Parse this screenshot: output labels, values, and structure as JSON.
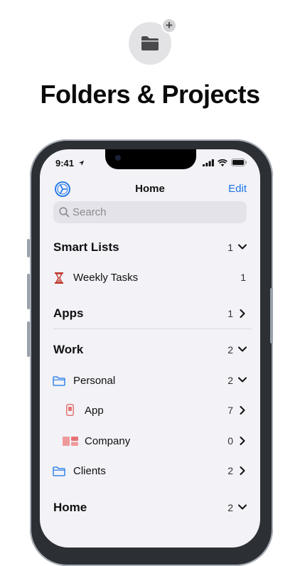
{
  "promo": {
    "headline": "Folders & Projects",
    "badge": "+"
  },
  "status_bar": {
    "time": "9:41"
  },
  "nav": {
    "title": "Home",
    "edit_label": "Edit"
  },
  "search": {
    "placeholder": "Search"
  },
  "sections": {
    "smart_lists": {
      "title": "Smart Lists",
      "count": "1",
      "expanded": true,
      "items": [
        {
          "label": "Weekly Tasks",
          "count": "1",
          "icon": "hourglass-icon"
        }
      ]
    },
    "apps": {
      "title": "Apps",
      "count": "1",
      "expanded": false
    },
    "work": {
      "title": "Work",
      "count": "2",
      "expanded": true,
      "items": [
        {
          "label": "Personal",
          "count": "2",
          "icon": "folder-icon",
          "expanded": true
        },
        {
          "label": "App",
          "count": "7",
          "icon": "phone-icon"
        },
        {
          "label": "Company",
          "count": "0",
          "icon": "board-icon"
        },
        {
          "label": "Clients",
          "count": "2",
          "icon": "folder-icon"
        }
      ]
    },
    "home": {
      "title": "Home",
      "count": "2",
      "expanded": true
    }
  },
  "colors": {
    "accent": "#1a73e8",
    "hourglass": "#c0392b",
    "project": "#e57373",
    "background": "#f2f2f7"
  }
}
